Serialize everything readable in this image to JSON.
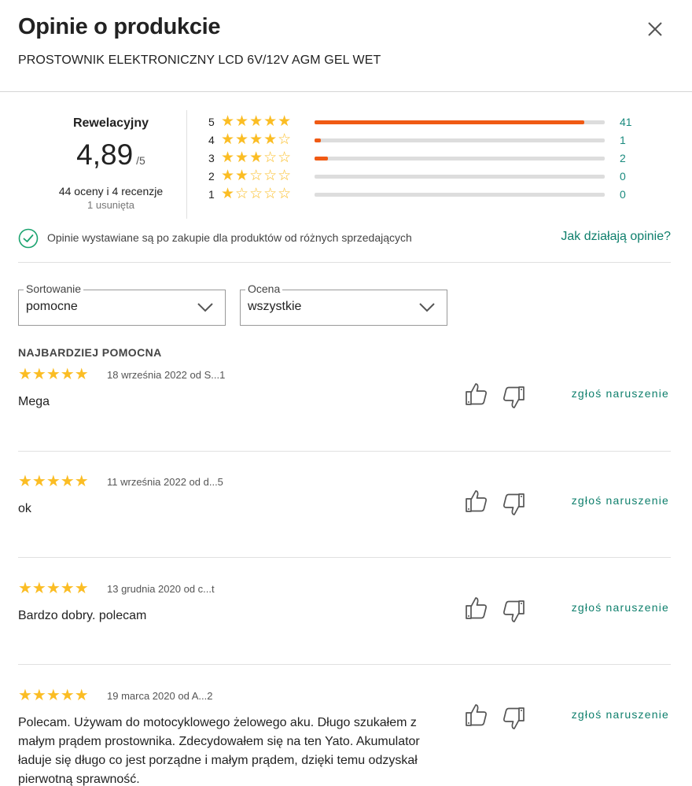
{
  "header": {
    "title": "Opinie o produkcie",
    "product_name": "PROSTOWNIK ELEKTRONICZNY LCD 6V/12V AGM GEL WET",
    "close_icon": "close-icon"
  },
  "summary": {
    "label": "Rewelacyjny",
    "score": "4,89",
    "score_max": "/5",
    "counts": "44 oceny i 4 recenzje",
    "removed": "1 usunięta",
    "distribution": [
      {
        "stars": "5",
        "glyphs": "★★★★★",
        "count": "41",
        "fraction": 0.93
      },
      {
        "stars": "4",
        "glyphs": "★★★★☆",
        "count": "1",
        "fraction": 0.023
      },
      {
        "stars": "3",
        "glyphs": "★★★☆☆",
        "count": "2",
        "fraction": 0.045
      },
      {
        "stars": "2",
        "glyphs": "★★☆☆☆",
        "count": "0",
        "fraction": 0
      },
      {
        "stars": "1",
        "glyphs": "★☆☆☆☆",
        "count": "0",
        "fraction": 0
      }
    ]
  },
  "info": {
    "text": "Opinie wystawiane są po zakupie dla produktów od różnych sprzedających",
    "link": "Jak działają opinie?"
  },
  "filters": {
    "sort": {
      "label": "Sortowanie",
      "value": "pomocne"
    },
    "rating": {
      "label": "Ocena",
      "value": "wszystkie"
    }
  },
  "section_title": "NAJBARDZIEJ POMOCNA",
  "reviews": [
    {
      "stars": "★★★★★",
      "meta": "18 września 2022 od S...1",
      "text": "Mega",
      "report": "zgłoś naruszenie"
    },
    {
      "stars": "★★★★★",
      "meta": "11 września 2022 od d...5",
      "text": "ok",
      "report": "zgłoś naruszenie"
    },
    {
      "stars": "★★★★★",
      "meta": "13 grudnia 2020 od c...t",
      "text": "Bardzo dobry. polecam",
      "report": "zgłoś naruszenie"
    },
    {
      "stars": "★★★★★",
      "meta": "19 marca 2020 od A...2",
      "text": "Polecam. Używam do motocyklowego żelowego aku. Długo szukałem z małym prądem prostownika. Zdecydowałem się na ten Yato. Akumulator ładuje się długo co jest porządne i małym prądem, dzięki temu odzyskał pierwotną sprawność.",
      "report": "zgłoś naruszenie"
    }
  ],
  "colors": {
    "star": "#fbbd24",
    "bar_fill": "#f05a14",
    "link": "#0e7f6c",
    "check": "#1aa36f"
  }
}
